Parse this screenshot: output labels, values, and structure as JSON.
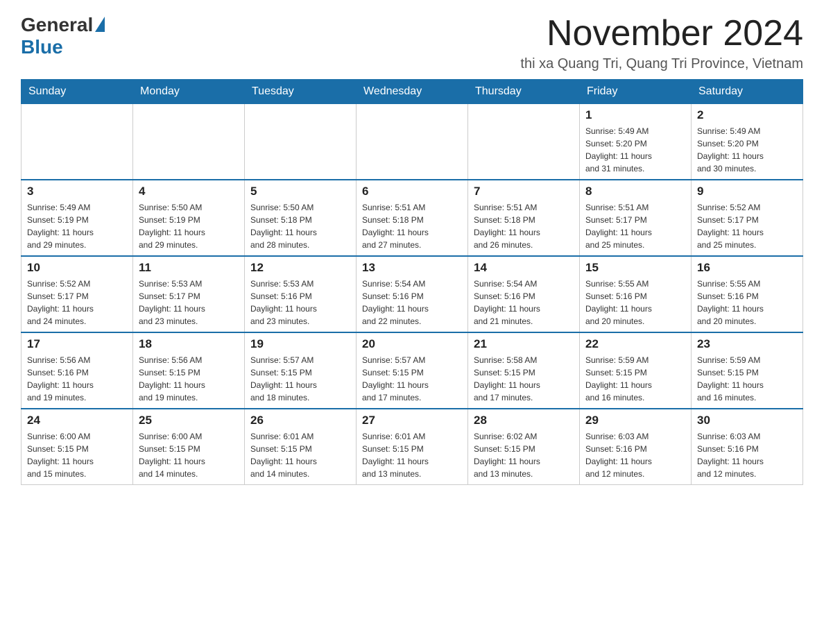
{
  "header": {
    "logo_general": "General",
    "logo_blue": "Blue",
    "month_title": "November 2024",
    "subtitle": "thi xa Quang Tri, Quang Tri Province, Vietnam"
  },
  "weekdays": [
    "Sunday",
    "Monday",
    "Tuesday",
    "Wednesday",
    "Thursday",
    "Friday",
    "Saturday"
  ],
  "weeks": [
    [
      {
        "day": "",
        "info": ""
      },
      {
        "day": "",
        "info": ""
      },
      {
        "day": "",
        "info": ""
      },
      {
        "day": "",
        "info": ""
      },
      {
        "day": "",
        "info": ""
      },
      {
        "day": "1",
        "info": "Sunrise: 5:49 AM\nSunset: 5:20 PM\nDaylight: 11 hours\nand 31 minutes."
      },
      {
        "day": "2",
        "info": "Sunrise: 5:49 AM\nSunset: 5:20 PM\nDaylight: 11 hours\nand 30 minutes."
      }
    ],
    [
      {
        "day": "3",
        "info": "Sunrise: 5:49 AM\nSunset: 5:19 PM\nDaylight: 11 hours\nand 29 minutes."
      },
      {
        "day": "4",
        "info": "Sunrise: 5:50 AM\nSunset: 5:19 PM\nDaylight: 11 hours\nand 29 minutes."
      },
      {
        "day": "5",
        "info": "Sunrise: 5:50 AM\nSunset: 5:18 PM\nDaylight: 11 hours\nand 28 minutes."
      },
      {
        "day": "6",
        "info": "Sunrise: 5:51 AM\nSunset: 5:18 PM\nDaylight: 11 hours\nand 27 minutes."
      },
      {
        "day": "7",
        "info": "Sunrise: 5:51 AM\nSunset: 5:18 PM\nDaylight: 11 hours\nand 26 minutes."
      },
      {
        "day": "8",
        "info": "Sunrise: 5:51 AM\nSunset: 5:17 PM\nDaylight: 11 hours\nand 25 minutes."
      },
      {
        "day": "9",
        "info": "Sunrise: 5:52 AM\nSunset: 5:17 PM\nDaylight: 11 hours\nand 25 minutes."
      }
    ],
    [
      {
        "day": "10",
        "info": "Sunrise: 5:52 AM\nSunset: 5:17 PM\nDaylight: 11 hours\nand 24 minutes."
      },
      {
        "day": "11",
        "info": "Sunrise: 5:53 AM\nSunset: 5:17 PM\nDaylight: 11 hours\nand 23 minutes."
      },
      {
        "day": "12",
        "info": "Sunrise: 5:53 AM\nSunset: 5:16 PM\nDaylight: 11 hours\nand 23 minutes."
      },
      {
        "day": "13",
        "info": "Sunrise: 5:54 AM\nSunset: 5:16 PM\nDaylight: 11 hours\nand 22 minutes."
      },
      {
        "day": "14",
        "info": "Sunrise: 5:54 AM\nSunset: 5:16 PM\nDaylight: 11 hours\nand 21 minutes."
      },
      {
        "day": "15",
        "info": "Sunrise: 5:55 AM\nSunset: 5:16 PM\nDaylight: 11 hours\nand 20 minutes."
      },
      {
        "day": "16",
        "info": "Sunrise: 5:55 AM\nSunset: 5:16 PM\nDaylight: 11 hours\nand 20 minutes."
      }
    ],
    [
      {
        "day": "17",
        "info": "Sunrise: 5:56 AM\nSunset: 5:16 PM\nDaylight: 11 hours\nand 19 minutes."
      },
      {
        "day": "18",
        "info": "Sunrise: 5:56 AM\nSunset: 5:15 PM\nDaylight: 11 hours\nand 19 minutes."
      },
      {
        "day": "19",
        "info": "Sunrise: 5:57 AM\nSunset: 5:15 PM\nDaylight: 11 hours\nand 18 minutes."
      },
      {
        "day": "20",
        "info": "Sunrise: 5:57 AM\nSunset: 5:15 PM\nDaylight: 11 hours\nand 17 minutes."
      },
      {
        "day": "21",
        "info": "Sunrise: 5:58 AM\nSunset: 5:15 PM\nDaylight: 11 hours\nand 17 minutes."
      },
      {
        "day": "22",
        "info": "Sunrise: 5:59 AM\nSunset: 5:15 PM\nDaylight: 11 hours\nand 16 minutes."
      },
      {
        "day": "23",
        "info": "Sunrise: 5:59 AM\nSunset: 5:15 PM\nDaylight: 11 hours\nand 16 minutes."
      }
    ],
    [
      {
        "day": "24",
        "info": "Sunrise: 6:00 AM\nSunset: 5:15 PM\nDaylight: 11 hours\nand 15 minutes."
      },
      {
        "day": "25",
        "info": "Sunrise: 6:00 AM\nSunset: 5:15 PM\nDaylight: 11 hours\nand 14 minutes."
      },
      {
        "day": "26",
        "info": "Sunrise: 6:01 AM\nSunset: 5:15 PM\nDaylight: 11 hours\nand 14 minutes."
      },
      {
        "day": "27",
        "info": "Sunrise: 6:01 AM\nSunset: 5:15 PM\nDaylight: 11 hours\nand 13 minutes."
      },
      {
        "day": "28",
        "info": "Sunrise: 6:02 AM\nSunset: 5:15 PM\nDaylight: 11 hours\nand 13 minutes."
      },
      {
        "day": "29",
        "info": "Sunrise: 6:03 AM\nSunset: 5:16 PM\nDaylight: 11 hours\nand 12 minutes."
      },
      {
        "day": "30",
        "info": "Sunrise: 6:03 AM\nSunset: 5:16 PM\nDaylight: 11 hours\nand 12 minutes."
      }
    ]
  ]
}
